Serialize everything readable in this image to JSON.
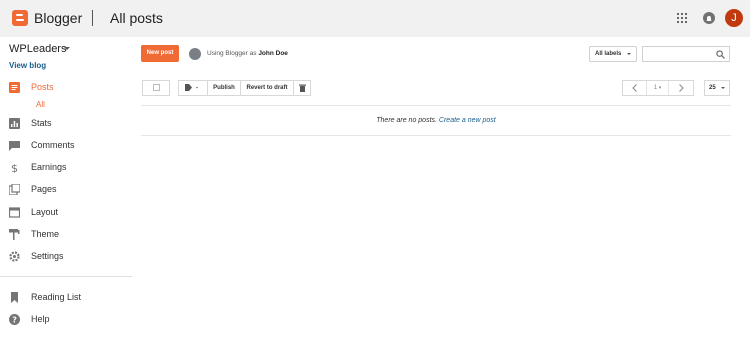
{
  "header": {
    "brand": "Blogger",
    "title": "All posts",
    "avatar_initial": "J"
  },
  "sidebar": {
    "blog_name": "WPLeaders",
    "view_blog": "View blog",
    "items": [
      {
        "label": "Posts",
        "icon": "posts-icon",
        "active": true
      },
      {
        "label": "Stats",
        "icon": "stats-icon"
      },
      {
        "label": "Comments",
        "icon": "comments-icon"
      },
      {
        "label": "Earnings",
        "icon": "dollar-icon"
      },
      {
        "label": "Pages",
        "icon": "pages-icon"
      },
      {
        "label": "Layout",
        "icon": "layout-icon"
      },
      {
        "label": "Theme",
        "icon": "paint-roller-icon"
      },
      {
        "label": "Settings",
        "icon": "gear-icon"
      },
      {
        "label": "Reading List",
        "icon": "bookmark-icon"
      },
      {
        "label": "Help",
        "icon": "help-icon"
      }
    ],
    "posts_sub": "All"
  },
  "main": {
    "new_post": "New post",
    "using_prefix": "Using Blogger as",
    "user_name": "John Doe",
    "labels_filter": "All labels",
    "toolbar": {
      "publish": "Publish",
      "revert": "Revert to draft"
    },
    "pager": {
      "page": "1"
    },
    "per_page": "25",
    "empty_text": "There are no posts.",
    "create_link": "Create a new post"
  },
  "colors": {
    "accent": "#f06a35",
    "link": "#1a5f8c"
  }
}
